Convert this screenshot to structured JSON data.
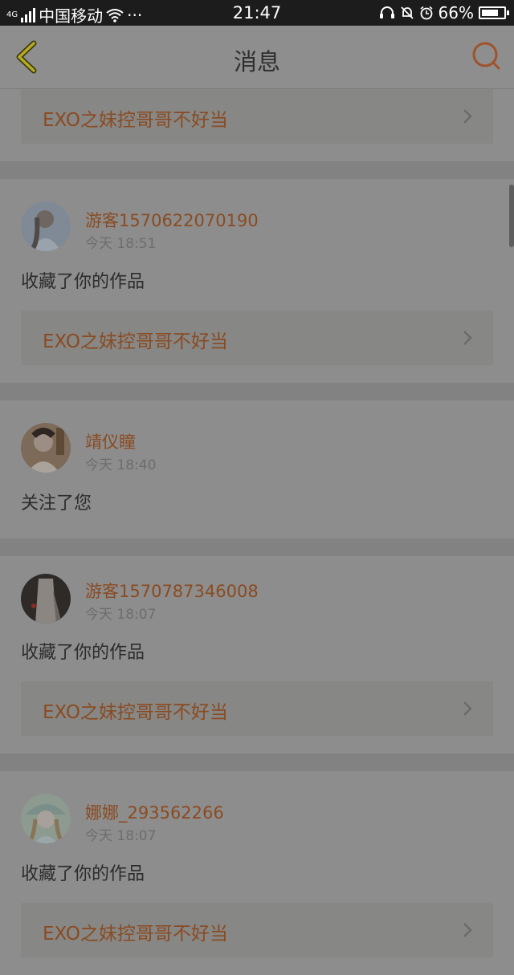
{
  "status_bar": {
    "network_type": "4G",
    "carrier": "中国移动",
    "more": "···",
    "time": "21:47",
    "battery_text": "66%",
    "battery_level": 0.66,
    "icons": [
      "signal-icon",
      "wifi-icon",
      "headset-icon",
      "silent-bell-icon",
      "alarm-icon",
      "battery-icon"
    ]
  },
  "header": {
    "title": "消息",
    "back_icon": "chevron-left-icon",
    "search_icon": "search-icon",
    "accent_color": "#b07a1a",
    "search_color": "#a0522d"
  },
  "top_partial_card": {
    "work_title": "EXO之妹控哥哥不好当"
  },
  "messages": [
    {
      "user": "游客1570622070190",
      "time": "今天 18:51",
      "action": "收藏了你的作品",
      "work_title": "EXO之妹控哥哥不好当"
    },
    {
      "user": "靖仪瞳",
      "time": "今天 18:40",
      "action": "关注了您"
    },
    {
      "user": "游客1570787346008",
      "time": "今天 18:07",
      "action": "收藏了你的作品",
      "work_title": "EXO之妹控哥哥不好当"
    },
    {
      "user": "娜娜_293562266",
      "time": "今天 18:07",
      "action": "收藏了你的作品",
      "work_title": "EXO之妹控哥哥不好当"
    }
  ]
}
